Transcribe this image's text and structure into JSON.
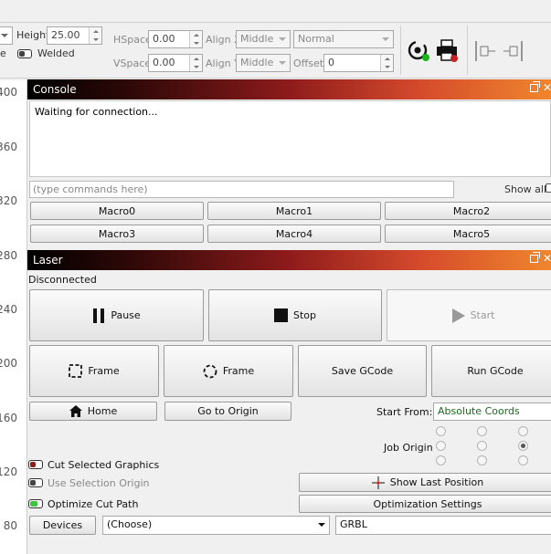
{
  "toolbar": {
    "height_label": "Height",
    "height_value": "25.00",
    "welded_label": "Welded",
    "left_partial_label": "e",
    "hspace_label": "HSpace",
    "hspace_value": "0.00",
    "vspace_label": "VSpace",
    "vspace_value": "0.00",
    "align_x_label": "Align X",
    "align_x_value": "Middle",
    "align_y_label": "Align Y",
    "align_y_value": "Middle",
    "mode_value": "Normal",
    "offset_label": "Offset",
    "offset_value": "0"
  },
  "ruler": {
    "ticks": [
      "400",
      "360",
      "320",
      "280",
      "240",
      "200",
      "160",
      "120",
      "80"
    ]
  },
  "console": {
    "title": "Console",
    "output": "Waiting for connection...",
    "input_placeholder": "(type commands here)",
    "show_all_label": "Show all",
    "macros": [
      "Macro0",
      "Macro1",
      "Macro2",
      "Macro3",
      "Macro4",
      "Macro5"
    ]
  },
  "laser": {
    "title": "Laser",
    "status": "Disconnected",
    "pause_label": "Pause",
    "stop_label": "Stop",
    "start_label": "Start",
    "frame1_label": "Frame",
    "frame2_label": "Frame",
    "save_gcode_label": "Save GCode",
    "run_gcode_label": "Run GCode",
    "home_label": "Home",
    "go_to_origin_label": "Go to Origin",
    "start_from_label": "Start From:",
    "start_from_value": "Absolute Coords",
    "job_origin_label": "Job Origin",
    "job_origin_selected": "middle-right",
    "cut_selected_label": "Cut Selected Graphics",
    "use_selection_origin_label": "Use Selection Origin",
    "optimize_cut_label": "Optimize Cut Path",
    "show_last_position_label": "Show Last Position",
    "optimization_settings_label": "Optimization Settings",
    "devices_label": "Devices",
    "device_choice": "(Choose)",
    "controller": "GRBL"
  },
  "colors": {
    "accent_red": "#b0211c",
    "toggle_green": "#3ec43e",
    "start_from_text": "#1b6a1b"
  }
}
